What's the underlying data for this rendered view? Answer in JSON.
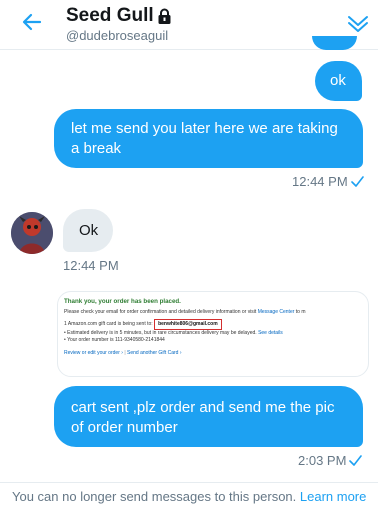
{
  "header": {
    "name": "Seed Gull",
    "handle": "@dudebroseaguil"
  },
  "messages": {
    "ok_text": "ok",
    "later_text": "let me send you later   here we are taking a break",
    "later_time": "12:44 PM",
    "reply_text": "Ok",
    "reply_time": "12:44 PM",
    "cart_text": "cart sent ,plz order and send me the pic of order number",
    "cart_time": "2:03 PM"
  },
  "receipt": {
    "heading": "Thank you, your order has been placed.",
    "line1_a": "Please check your email for order confirmation and detailed delivery information or visit",
    "line1_link": "Message Center",
    "line1_b": "to m",
    "line2_a": "1 Amazon.com gift card is being sent to:",
    "email": "benwhite806@gmail.com",
    "bullet1_a": "Estimated delivery is in 5 minutes, but in rare circumstances delivery may be delayed.",
    "bullet1_link": "See details",
    "bullet2": "Your order number is 111-9340580-2141844",
    "foot_review": "Review or edit your order ›",
    "foot_another": "Send another Gift Card ›"
  },
  "footer": {
    "notice": "You can no longer send messages to this person.",
    "learn_more": "Learn more"
  },
  "colors": {
    "accent": "#1da1f2",
    "incoming_bubble": "#e6ecf0"
  },
  "icons": {
    "back": "back-arrow-icon",
    "lock": "lock-icon",
    "chevron": "chevron-down-icon",
    "read": "check-icon"
  }
}
